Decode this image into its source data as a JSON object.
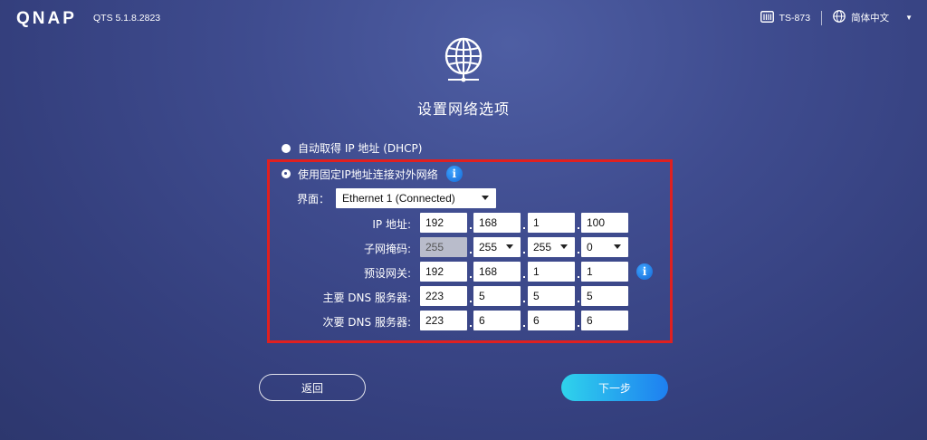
{
  "header": {
    "logo": "QNAP",
    "version": "QTS 5.1.8.2823",
    "device": "TS-873",
    "language": "简体中文"
  },
  "page": {
    "title": "设置网络选项"
  },
  "options": {
    "dhcp_label": "自动取得 IP 地址 (DHCP)",
    "static_label": "使用固定IP地址连接对外网络",
    "selected": "static"
  },
  "interface": {
    "label": "界面：",
    "value": "Ethernet 1 (Connected)"
  },
  "fields": {
    "ip": {
      "label": "IP 地址:",
      "octets": [
        "192",
        "168",
        "1",
        "100"
      ]
    },
    "mask": {
      "label": "子网掩码:",
      "octets": [
        "255",
        "255",
        "255",
        "0"
      ]
    },
    "gateway": {
      "label": "预设网关:",
      "octets": [
        "192",
        "168",
        "1",
        "1"
      ]
    },
    "dns1": {
      "label": "主要 DNS 服务器:",
      "octets": [
        "223",
        "5",
        "5",
        "5"
      ]
    },
    "dns2": {
      "label": "次要 DNS 服务器:",
      "octets": [
        "223",
        "6",
        "6",
        "6"
      ]
    }
  },
  "buttons": {
    "back": "返回",
    "next": "下一步"
  },
  "colors": {
    "highlight": "#e02020",
    "accent_start": "#2fd3ec",
    "accent_end": "#1e7ff0",
    "info": "#1468d6"
  }
}
